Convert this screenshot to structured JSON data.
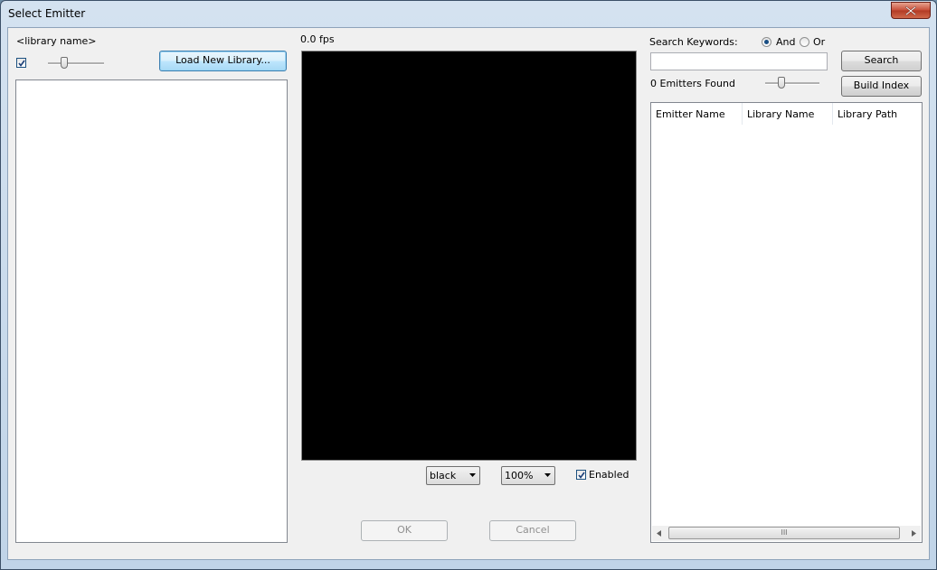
{
  "window": {
    "title": "Select Emitter"
  },
  "library": {
    "name_label": "<library name>",
    "checkbox_checked": true,
    "load_button_label": "Load New Library..."
  },
  "preview": {
    "fps_label": "0.0 fps",
    "background_color": "#000000",
    "bg_select_value": "black",
    "zoom_select_value": "100%",
    "enabled_label": "Enabled",
    "enabled_checked": true
  },
  "search": {
    "keywords_label": "Search Keywords:",
    "and_label": "And",
    "or_label": "Or",
    "selected_mode": "And",
    "input_value": "",
    "search_button_label": "Search",
    "found_label": "0 Emitters Found",
    "build_index_button_label": "Build Index",
    "columns": [
      "Emitter Name",
      "Library Name",
      "Library Path"
    ],
    "rows": [],
    "scroll_grip": "III"
  },
  "footer": {
    "ok_label": "OK",
    "cancel_label": "Cancel"
  }
}
